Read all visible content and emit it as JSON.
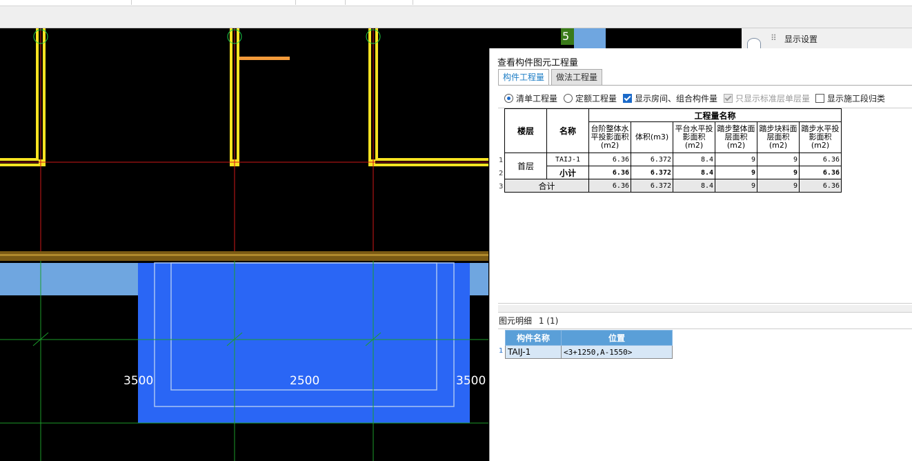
{
  "cad": {
    "axes": [
      "5"
    ],
    "dimensions": [
      "3500",
      "2500",
      "3500"
    ]
  },
  "right_strip": {
    "label": "显示设置"
  },
  "panel": {
    "title": "查看构件图元工程量",
    "tabs": [
      "构件工程量",
      "做法工程量"
    ],
    "options": {
      "radio_list": "清单工程量",
      "radio_quota": "定额工程量",
      "chk_room": "显示房间、组合构件量",
      "chk_std": "只显示标准层单层量",
      "chk_stage": "显示施工段归类"
    },
    "table": {
      "header_floor": "楼层",
      "header_name": "名称",
      "header_group": "工程量名称",
      "columns": [
        "台阶整体水平投影面积(m2)",
        "体积(m3)",
        "平台水平投影面积(m2)",
        "踏步整体面层面积(m2)",
        "踏步块料面层面积(m2)",
        "踏步水平投影面积(m2)"
      ],
      "rows": [
        {
          "num": "1",
          "floor": "首层",
          "name": "TAIJ-1",
          "values": [
            "6.36",
            "6.372",
            "8.4",
            "9",
            "9",
            "6.36"
          ]
        },
        {
          "num": "2",
          "name": "小计",
          "values": [
            "6.36",
            "6.372",
            "8.4",
            "9",
            "9",
            "6.36"
          ]
        },
        {
          "num": "3",
          "name": "合计",
          "values": [
            "6.36",
            "6.372",
            "8.4",
            "9",
            "9",
            "6.36"
          ]
        }
      ]
    },
    "detail": {
      "title": "图元明细",
      "count": "1 (1)",
      "headers": [
        "构件名称",
        "位置"
      ],
      "row_num": "1",
      "name": "TAIJ-1",
      "position": "<3+1250,A-1550>"
    }
  }
}
